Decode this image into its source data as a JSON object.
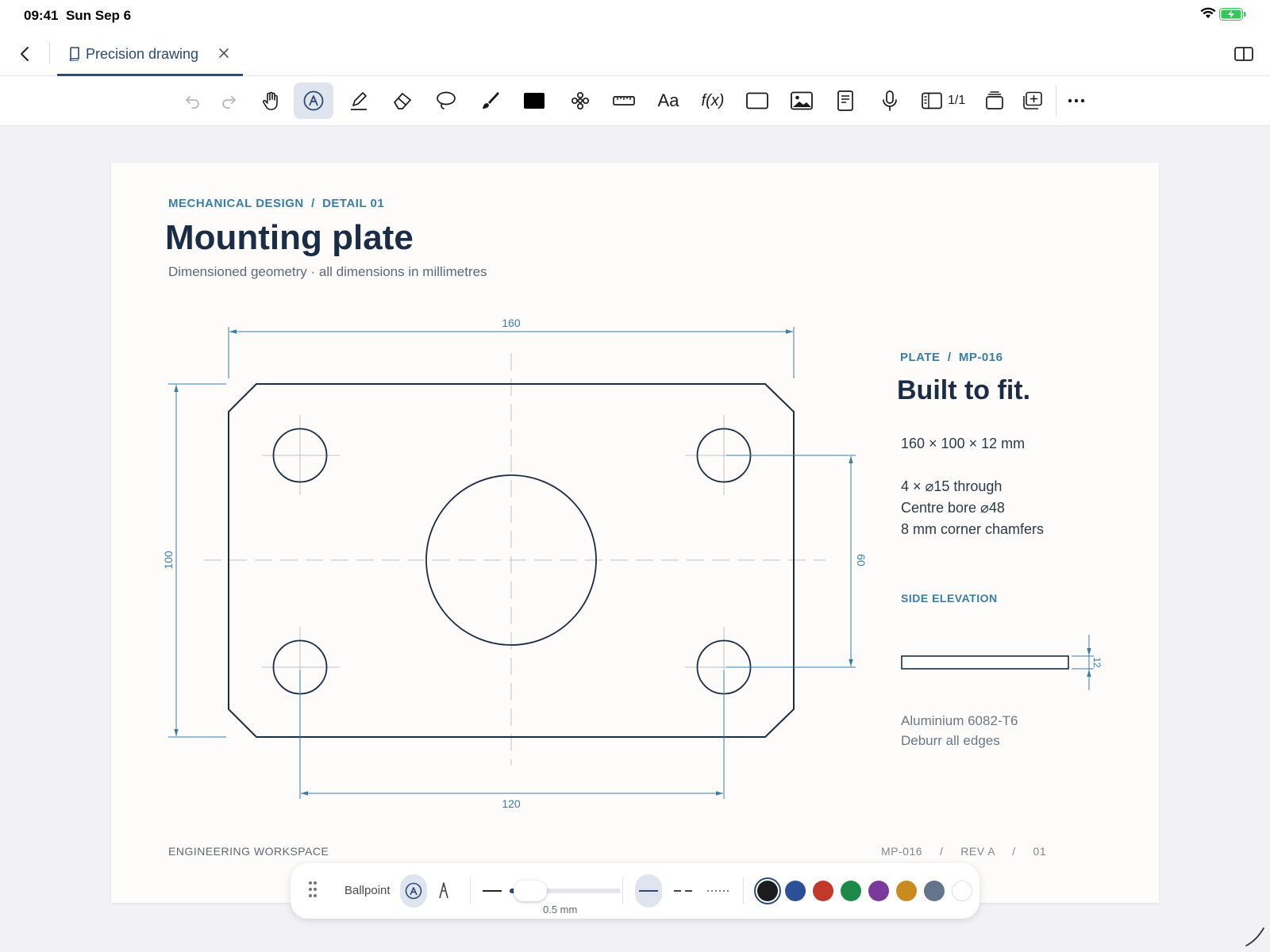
{
  "status": {
    "time": "09:41",
    "date": "Sun Sep 6",
    "wifi_icon": "wifi-icon",
    "battery_icon": "battery-charging-icon"
  },
  "tabbar": {
    "back_icon": "chevron-left-icon",
    "tab_label": "Precision drawing",
    "tab_icon": "book-icon",
    "close_icon": "close-icon",
    "split_icon": "split-view-icon"
  },
  "toolbar": {
    "tools": [
      "undo",
      "redo",
      "hand",
      "pen",
      "highlighter",
      "eraser",
      "lasso",
      "brush",
      "shape",
      "sticker",
      "ruler",
      "text",
      "formula",
      "frame",
      "image",
      "page",
      "microphone",
      "page-layout",
      "pages",
      "add-page",
      "more"
    ],
    "text_tool_label": "Aa",
    "formula_label": "f(x)",
    "page_count": "1/1",
    "active_tool": "pen"
  },
  "paper": {
    "breadcrumb": "MECHANICAL DESIGN  /  DETAIL 01",
    "title": "Mounting plate",
    "subtitle": "Dimensioned geometry · all dimensions in millimetres",
    "dimensions": {
      "width": "160",
      "height": "100",
      "hole_spacing_x": "120",
      "hole_spacing_y": "60",
      "thickness": "12"
    },
    "spec": {
      "tag": "PLATE  /  MP-016",
      "title": "Built to fit.",
      "size": "160 × 100 × 12 mm",
      "holes": "4 × ⌀15 through",
      "bore": "Centre bore ⌀48",
      "chamfers": "8 mm corner chamfers",
      "side_tag": "SIDE ELEVATION",
      "material": "Aluminium 6082-T6",
      "finish": "Deburr all edges"
    },
    "footer_left": "ENGINEERING WORKSPACE",
    "footer_right": "MP-016     /     REV A     /     01"
  },
  "pen_panel": {
    "pen_name": "Ballpoint",
    "size_label": "0.5 mm",
    "size_fraction": 0.08,
    "line_styles": [
      "solid",
      "dashed",
      "dotted"
    ],
    "active_style": "solid",
    "colors": [
      "#1c1c1e",
      "#2c4f97",
      "#c0392b",
      "#1e8a4a",
      "#7b3a9b",
      "#c98a1e",
      "#64748b",
      "#ffffff"
    ],
    "selected_color": "#1c1c1e"
  },
  "colors": {
    "accent": "#3a7ea8",
    "ink": "#1b2d44",
    "tab_accent": "#2d4a74"
  }
}
